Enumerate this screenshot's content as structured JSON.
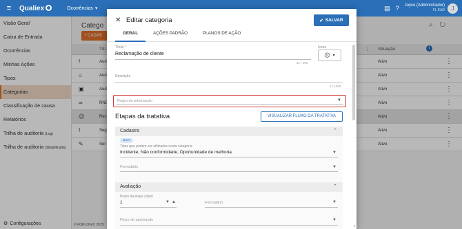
{
  "topbar": {
    "brand": "Qualiex",
    "module": "Ocorrências",
    "user_name": "Joyce (Administrador)",
    "user_sub": "FL EAD",
    "avatar_initial": "J"
  },
  "sidebar": {
    "items": [
      {
        "label": "Visão Geral"
      },
      {
        "label": "Caixa de Entrada"
      },
      {
        "label": "Ocorrências"
      },
      {
        "label": "Minhas Ações"
      },
      {
        "label": "Tipos"
      },
      {
        "label": "Categorias",
        "active": true
      },
      {
        "label": "Classificação de causa"
      },
      {
        "label": "Relatórios"
      },
      {
        "label": "Trilha de auditoria",
        "suffix": "(Log)"
      },
      {
        "label": "Trilha de auditoria",
        "suffix": "(Simplificada)"
      }
    ],
    "config_label": "Configurações"
  },
  "background": {
    "page_title": "Catego",
    "add_button": "+ CADAS",
    "col_title": "Títi",
    "col_status": "Situação",
    "rows": [
      {
        "icon": "!",
        "name": "Aud",
        "status": "Ativo"
      },
      {
        "icon": "⌂",
        "name": "Aud",
        "status": "Ativo"
      },
      {
        "icon": "▣",
        "name": "Aud",
        "status": "Ativo"
      },
      {
        "icon": "∞",
        "name": "RNC",
        "status": "Ativo"
      },
      {
        "icon": "☹",
        "name": "Rec",
        "status": "Ativo",
        "selected": true
      },
      {
        "icon": "!",
        "name": "Seg",
        "status": "Ativo"
      },
      {
        "icon": "✎",
        "name": "Ser",
        "status": "Ativo"
      }
    ],
    "footer": "© FORLOGIC 2025"
  },
  "dialog": {
    "title": "Editar categoria",
    "save_label": "SALVAR",
    "tabs": [
      "GERAL",
      "AÇÕES PADRÃO",
      "PLANOS DE AÇÃO"
    ],
    "titulo_label": "Título *",
    "titulo_value": "Reclamação de cliente",
    "titulo_counter": "21 / 150",
    "icone_label": "Ícone",
    "icone_glyph": "☹",
    "descricao_label": "Descrição",
    "descricao_counter": "0 / 1000",
    "regra_placeholder": "Regra de priorização",
    "etapas_title": "Etapas da tratativa",
    "flow_button": "VISUALIZAR FLUXO DA TRATATIVA",
    "cadastro": {
      "header": "Cadastro",
      "chip": "Novo",
      "tipos_label": "Tipos que podem ser utilizados nesta categoria",
      "tipos_value": "Incidente, Não conformidade, Oportunidade de melhoria",
      "formulario_placeholder": "Formulário"
    },
    "avaliacao": {
      "header": "Avaliação",
      "prazo_label": "Prazo da etapa (dias)",
      "prazo_value": "1",
      "formulario_placeholder": "Formulário",
      "fluxo_placeholder": "Fluxo de aprovação"
    }
  }
}
